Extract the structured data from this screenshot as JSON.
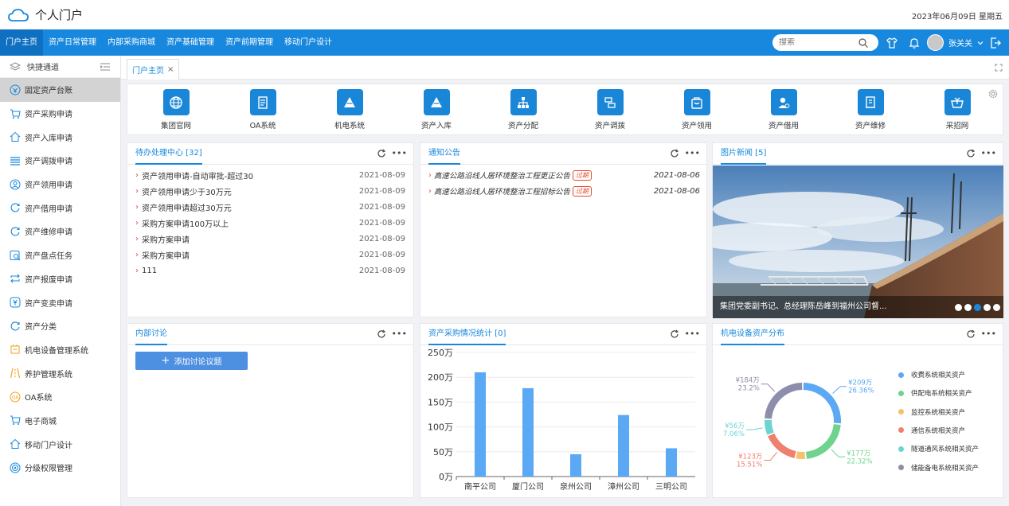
{
  "app": {
    "title": "个人门户",
    "date": "2023年06月09日  星期五"
  },
  "nav": {
    "items": [
      "门户主页",
      "资产日常管理",
      "内部采购商城",
      "资产基础管理",
      "资产前期管理",
      "移动门户设计"
    ],
    "search_placeholder": "搜索",
    "user": "张关关"
  },
  "sidebar": {
    "header": "快捷通道",
    "items": [
      "固定资产台账",
      "资产采购申请",
      "资产入库申请",
      "资产调拨申请",
      "资产领用申请",
      "资产借用申请",
      "资产维修申请",
      "资产盘点任务",
      "资产报废申请",
      "资产变卖申请",
      "资产分类",
      "机电设备管理系统",
      "养护管理系统",
      "OA系统",
      "电子商城",
      "移动门户设计",
      "分级权限管理"
    ]
  },
  "tabs": [
    {
      "label": "门户主页",
      "close": "×"
    }
  ],
  "quicklinks": [
    "集团官网",
    "OA系统",
    "机电系统",
    "资产入库",
    "资产分配",
    "资产调拨",
    "资产领用",
    "资产借用",
    "资产维修",
    "采招网"
  ],
  "todo": {
    "title": "待办处理中心 [32]",
    "items": [
      {
        "text": "资产领用申请-自动审批-超过30",
        "date": "2021-08-09"
      },
      {
        "text": "资产领用申请少于30万元",
        "date": "2021-08-09"
      },
      {
        "text": "资产领用申请超过30万元",
        "date": "2021-08-09"
      },
      {
        "text": "采购方案申请100万以上",
        "date": "2021-08-09"
      },
      {
        "text": "采购方案申请",
        "date": "2021-08-09"
      },
      {
        "text": "采购方案申请",
        "date": "2021-08-09"
      },
      {
        "text": "111",
        "date": "2021-08-09"
      }
    ]
  },
  "notice": {
    "title": "通知公告",
    "items": [
      {
        "text": "高速公路沿线人居环境整治工程更正公告",
        "badge": "过期",
        "date": "2021-08-06"
      },
      {
        "text": "高速公路沿线人居环境整治工程招标公告",
        "badge": "过期",
        "date": "2021-08-06"
      }
    ]
  },
  "news": {
    "title": "图片新闻 [5]",
    "caption": "集团党委副书记、总经理陈岳峰到福州公司督..."
  },
  "discussion": {
    "title": "内部讨论",
    "add_button": "添加讨论议题",
    "add_icon": "+"
  },
  "procurement": {
    "title": "资产采购情况统计 [0]"
  },
  "distribution": {
    "title": "机电设备资产分布"
  },
  "colors": {
    "primary": "#1788dd",
    "bar": "#5ba8f5",
    "badge": "#e24a2b"
  },
  "chart_data": [
    {
      "type": "bar",
      "categories": [
        "南平公司",
        "厦门公司",
        "泉州公司",
        "漳州公司",
        "三明公司"
      ],
      "values": [
        2100000,
        1780000,
        450000,
        1240000,
        570000
      ],
      "ylim": [
        0,
        2500000
      ],
      "yticks": [
        "0万",
        "50万",
        "100万",
        "150万",
        "200万",
        "250万"
      ]
    },
    {
      "type": "pie",
      "slices": [
        {
          "name": "收费系统相关资产",
          "value_label": "¥209万",
          "pct_label": "26.36%",
          "pct": 26.36,
          "color": "#5ba8f5"
        },
        {
          "name": "供配电系统相关资产",
          "value_label": "¥177万",
          "pct_label": "22.32%",
          "pct": 22.32,
          "color": "#6fd38f"
        },
        {
          "name": "监控系统相关资产",
          "value_label": "",
          "pct_label": "",
          "pct": 4.5,
          "color": "#f5c26b"
        },
        {
          "name": "通信系统相关资产",
          "value_label": "¥123万",
          "pct_label": "15.51%",
          "pct": 15.51,
          "color": "#ef7f6f"
        },
        {
          "name": "隧道通风系统相关资产",
          "value_label": "¥56万",
          "pct_label": "7.06%",
          "pct": 7.06,
          "color": "#6fd3d3"
        },
        {
          "name": "储能备电系统相关资产",
          "value_label": "¥184万",
          "pct_label": "23.2%",
          "pct": 24.25,
          "color": "#8c8eab"
        }
      ]
    }
  ]
}
